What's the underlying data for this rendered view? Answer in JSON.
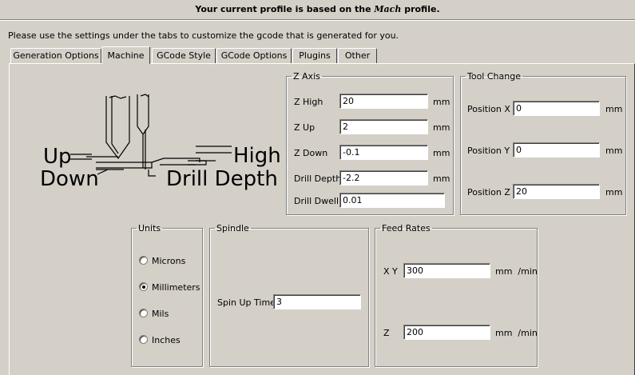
{
  "header": {
    "banner_prefix": "Your current profile is based on the ",
    "profile_name": "Mach",
    "banner_suffix": " profile."
  },
  "intro": "Please use the settings under the tabs to customize the gcode that is generated for you.",
  "tabs": [
    {
      "label": "Generation Options",
      "active": false
    },
    {
      "label": "Machine",
      "active": true
    },
    {
      "label": "GCode Style",
      "active": false
    },
    {
      "label": "GCode Options",
      "active": false
    },
    {
      "label": "Plugins",
      "active": false
    },
    {
      "label": "Other",
      "active": false
    }
  ],
  "diagram": {
    "up": "Up",
    "down": "Down",
    "high": "High",
    "drill_depth": "Drill Depth"
  },
  "z_axis": {
    "title": "Z Axis",
    "fields": [
      {
        "label": "Z High",
        "value": "20",
        "unit": "mm"
      },
      {
        "label": "Z Up",
        "value": "2",
        "unit": "mm"
      },
      {
        "label": "Z Down",
        "value": "-0.1",
        "unit": "mm"
      },
      {
        "label": "Drill Depth",
        "value": "-2.2",
        "unit": "mm"
      },
      {
        "label": "Drill Dwell",
        "value": "0.01",
        "unit": ""
      }
    ]
  },
  "tool_change": {
    "title": "Tool Change",
    "fields": [
      {
        "label": "Position X",
        "value": "0",
        "unit": "mm"
      },
      {
        "label": "Position Y",
        "value": "0",
        "unit": "mm"
      },
      {
        "label": "Position Z",
        "value": "20",
        "unit": "mm"
      }
    ]
  },
  "units": {
    "title": "Units",
    "options": [
      {
        "label": "Microns",
        "checked": false
      },
      {
        "label": "Millimeters",
        "checked": true
      },
      {
        "label": "Mils",
        "checked": false
      },
      {
        "label": "Inches",
        "checked": false
      }
    ]
  },
  "spindle": {
    "title": "Spindle",
    "spin_up_label": "Spin Up Time",
    "spin_up_value": "3"
  },
  "feed_rates": {
    "title": "Feed Rates",
    "xy_label": "X Y",
    "xy_value": "300",
    "xy_unit": "mm  /min",
    "z_label": "Z",
    "z_value": "200",
    "z_unit": "mm  /min"
  }
}
